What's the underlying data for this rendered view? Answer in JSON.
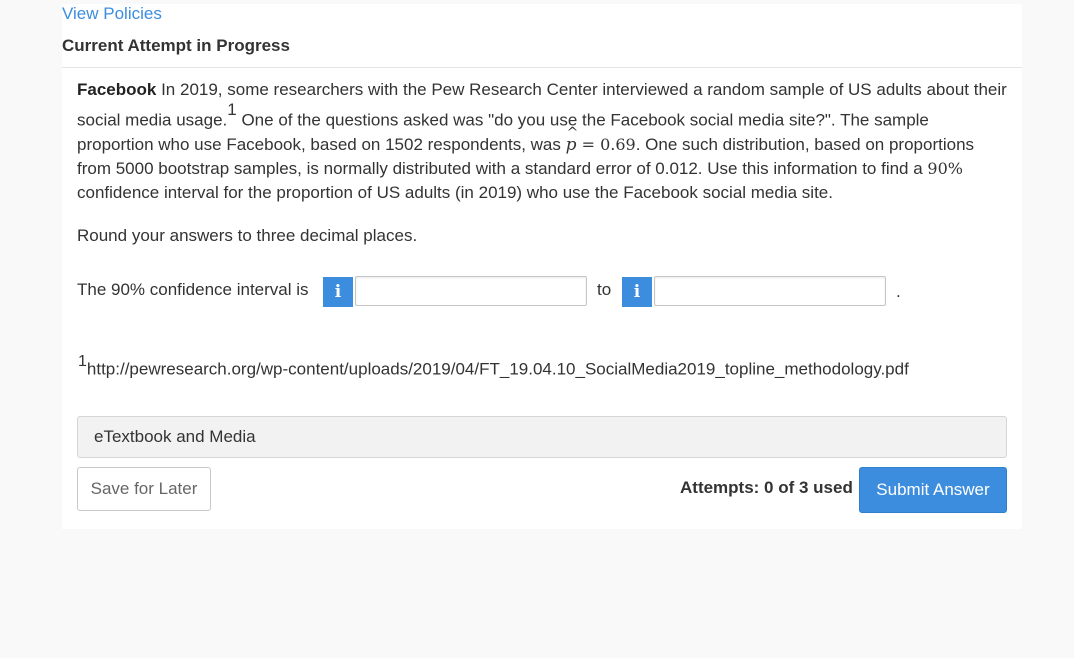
{
  "header": {
    "view_policies": "View Policies",
    "attempt_title": "Current Attempt in Progress"
  },
  "question": {
    "title": "Facebook",
    "part1": " In 2019, some researchers with the Pew Research Center interviewed a random sample of US adults about their social media usage.",
    "footnote_marker": "1",
    "part2": " One of the questions asked was \"do you use the Facebook social media site?\". The sample proportion who use Facebook, based on 1502 respondents, was ",
    "phat_symbol": "p",
    "phat_hat": "^",
    "phat_value": " = 0.69",
    "part3": ". One such distribution, based on proportions from 5000 bootstrap samples, is normally distributed with a standard error of 0.012. Use this information to find a ",
    "confidence_level": "90%",
    "part4": " confidence interval for the proportion of US adults (in 2019) who use the Facebook social media site."
  },
  "instructions": "Round your answers to three decimal places.",
  "answer": {
    "label": "The 90% confidence interval is",
    "to_text": "to",
    "period": ".",
    "info_icon": "i",
    "lower_value": "",
    "upper_value": ""
  },
  "footnote": {
    "marker": "1",
    "url": "http://pewresearch.org/wp-content/uploads/2019/04/FT_19.04.10_SocialMedia2019_topline_methodology.pdf"
  },
  "etextbook": "eTextbook and Media",
  "footer": {
    "save_label": "Save for Later",
    "attempts": "Attempts: 0 of 3 used",
    "submit_label": "Submit Answer"
  },
  "colors": {
    "accent": "#3c8dde",
    "background": "#f9f9f9"
  }
}
